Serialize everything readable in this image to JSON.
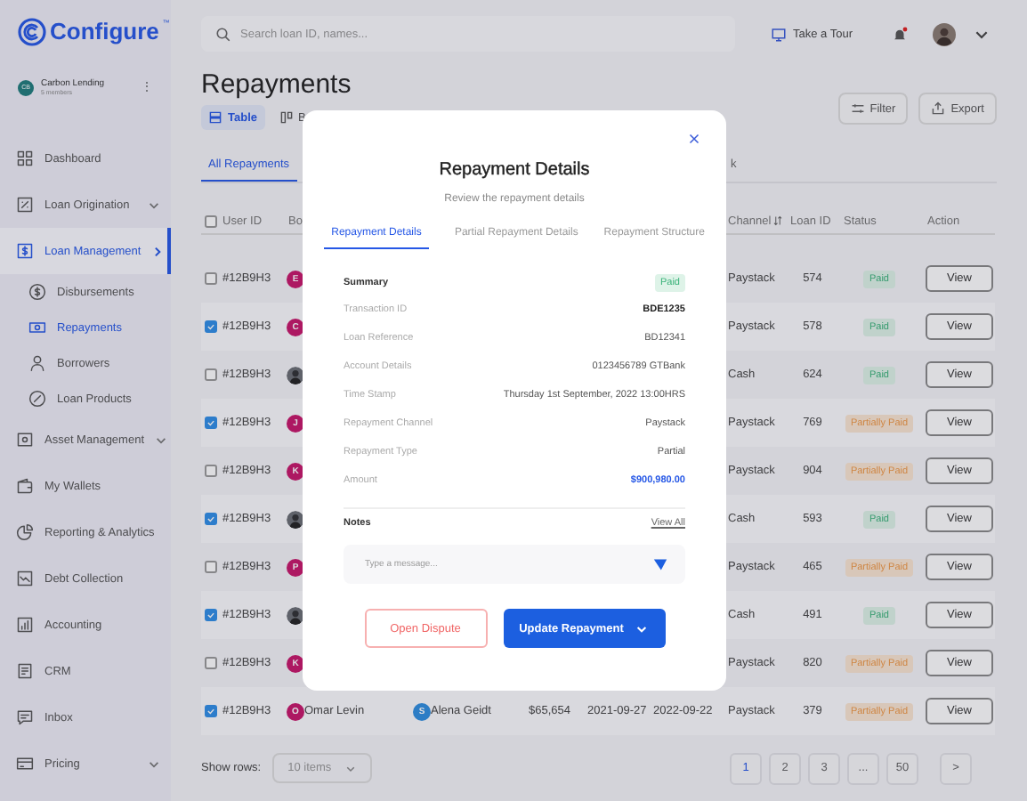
{
  "brand": {
    "name": "Configure",
    "mark": "™"
  },
  "org": {
    "initials": "CB",
    "name": "Carbon Lending",
    "members": "5 members",
    "menu": "⋮"
  },
  "sidebar": {
    "items": [
      {
        "label": "Dashboard",
        "selected": false
      },
      {
        "label": "Loan Origination",
        "selected": false,
        "expanded": false
      },
      {
        "label": "Loan Management",
        "selected": true,
        "expanded": true,
        "children": [
          {
            "label": "Disbursements",
            "selected": false
          },
          {
            "label": "Repayments",
            "selected": true
          },
          {
            "label": "Borrowers",
            "selected": false
          },
          {
            "label": "Loan Products",
            "selected": false
          }
        ]
      },
      {
        "label": "Asset Management",
        "selected": false,
        "expanded": false
      },
      {
        "label": "My Wallets",
        "selected": false
      },
      {
        "label": "Reporting & Analytics",
        "selected": false
      },
      {
        "label": "Debt Collection",
        "selected": false
      },
      {
        "label": "Accounting",
        "selected": false
      },
      {
        "label": "CRM",
        "selected": false
      },
      {
        "label": "Inbox",
        "selected": false
      },
      {
        "label": "Pricing",
        "selected": false,
        "expanded": false
      }
    ]
  },
  "header": {
    "search_placeholder": "Search loan ID, names...",
    "tour": "Take a Tour",
    "notifications_unread": true
  },
  "page": {
    "title": "Repayments",
    "views": [
      {
        "label": "Table",
        "selected": true
      },
      {
        "label": "B",
        "selected": false
      }
    ],
    "actions": [
      "Filter",
      "Export"
    ],
    "tabs": [
      {
        "label": "All Repayments",
        "selected": true
      },
      {
        "label": "k",
        "selected": false
      }
    ]
  },
  "table": {
    "all_checked": false,
    "columns": [
      {
        "label": "User ID"
      },
      {
        "label": "Bo"
      },
      {
        "label": "Channel",
        "sortable": true
      },
      {
        "label": "Loan ID"
      },
      {
        "label": "Status"
      },
      {
        "label": "Action"
      }
    ],
    "rows": [
      {
        "checked": false,
        "user_id": "#12B9H3",
        "avatar": {
          "kind": "initial",
          "letter": "E"
        },
        "channel": "Paystack",
        "loan_id": "574",
        "status": {
          "label": "Paid",
          "kind": "paid"
        },
        "action": "View"
      },
      {
        "checked": true,
        "user_id": "#12B9H3",
        "avatar": {
          "kind": "initial",
          "letter": "C"
        },
        "channel": "Paystack",
        "loan_id": "578",
        "status": {
          "label": "Paid",
          "kind": "paid"
        },
        "action": "View"
      },
      {
        "checked": false,
        "user_id": "#12B9H3",
        "avatar": {
          "kind": "photo"
        },
        "channel": "Cash",
        "loan_id": "624",
        "status": {
          "label": "Paid",
          "kind": "paid"
        },
        "action": "View"
      },
      {
        "checked": true,
        "user_id": "#12B9H3",
        "avatar": {
          "kind": "initial",
          "letter": "J"
        },
        "channel": "Paystack",
        "loan_id": "769",
        "status": {
          "label": "Partially Paid",
          "kind": "partial"
        },
        "action": "View"
      },
      {
        "checked": false,
        "user_id": "#12B9H3",
        "avatar": {
          "kind": "initial",
          "letter": "K"
        },
        "channel": "Paystack",
        "loan_id": "904",
        "status": {
          "label": "Partially Paid",
          "kind": "partial"
        },
        "action": "View"
      },
      {
        "checked": true,
        "user_id": "#12B9H3",
        "avatar": {
          "kind": "photo"
        },
        "channel": "Cash",
        "loan_id": "593",
        "status": {
          "label": "Paid",
          "kind": "paid"
        },
        "action": "View"
      },
      {
        "checked": false,
        "user_id": "#12B9H3",
        "avatar": {
          "kind": "initial",
          "letter": "P"
        },
        "channel": "Paystack",
        "loan_id": "465",
        "status": {
          "label": "Partially Paid",
          "kind": "partial"
        },
        "action": "View"
      },
      {
        "checked": true,
        "user_id": "#12B9H3",
        "avatar": {
          "kind": "photo"
        },
        "channel": "Cash",
        "loan_id": "491",
        "status": {
          "label": "Paid",
          "kind": "paid"
        },
        "action": "View"
      },
      {
        "checked": false,
        "user_id": "#12B9H3",
        "avatar": {
          "kind": "initial",
          "letter": "K"
        },
        "channel": "Paystack",
        "loan_id": "820",
        "status": {
          "label": "Partially Paid",
          "kind": "partial"
        },
        "action": "View"
      },
      {
        "checked": true,
        "user_id": "#12B9H3",
        "avatar": {
          "kind": "initial",
          "letter": "O"
        },
        "borrower": "Omar Levin",
        "agent_avatar": {
          "kind": "initial",
          "letter": "S"
        },
        "agent": "Alena Geidt",
        "amount": "$65,654",
        "date_1": "2021-09-27",
        "date_2": "2022-09-22",
        "channel": "Paystack",
        "loan_id": "379",
        "status": {
          "label": "Partially Paid",
          "kind": "partial"
        },
        "action": "View"
      }
    ]
  },
  "footer": {
    "show_rows": "Show rows:",
    "rows_select": "10 items",
    "pages": [
      {
        "label": "1",
        "selected": true
      },
      {
        "label": "2",
        "selected": false
      },
      {
        "label": "3",
        "selected": false
      },
      {
        "label": "...",
        "selected": false
      },
      {
        "label": "50",
        "selected": false
      }
    ],
    "next": ">"
  },
  "modal": {
    "title": "Repayment Details",
    "subtitle": "Review the repayment details",
    "tabs": [
      {
        "label": "Repayment Details",
        "selected": true
      },
      {
        "label": "Partial Repayment Details",
        "selected": false
      },
      {
        "label": "Repayment Structure",
        "selected": false
      }
    ],
    "summary": {
      "label": "Summary",
      "status": "Paid"
    },
    "fields": [
      {
        "label": "Transaction ID",
        "value": "BDE1235",
        "kind": "strong"
      },
      {
        "label": "Loan Reference",
        "value": "BD12341",
        "kind": "plain"
      },
      {
        "label": "Account Details",
        "value": "0123456789 GTBank",
        "kind": "plain"
      },
      {
        "label": "Time Stamp",
        "value": "Thursday 1st September, 2022 13:00HRS",
        "kind": "plain"
      },
      {
        "label": "Repayment Channel",
        "value": "Paystack",
        "kind": "plain"
      },
      {
        "label": "Repayment Type",
        "value": "Partial",
        "kind": "plain"
      },
      {
        "label": "Amount",
        "value": "$900,980.00",
        "kind": "amount"
      }
    ],
    "notes": {
      "label": "Notes",
      "link": "View All",
      "placeholder": "Type a message..."
    },
    "buttons": [
      {
        "label": "Open Dispute",
        "kind": "secondary"
      },
      {
        "label": "Update Repayment",
        "kind": "primary"
      }
    ]
  }
}
